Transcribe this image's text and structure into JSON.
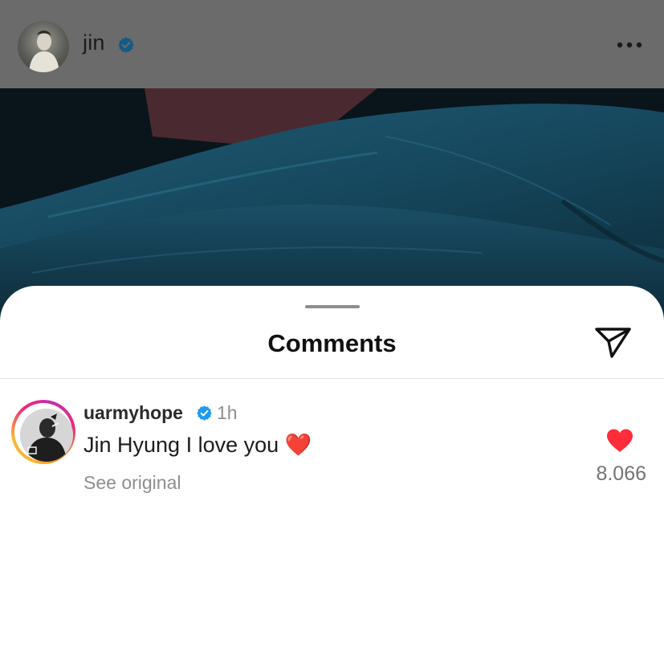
{
  "post": {
    "username": "jin",
    "verified": true,
    "more_icon": "more-horizontal-icon"
  },
  "comments_sheet": {
    "title": "Comments",
    "share_icon": "paper-plane-icon"
  },
  "comments": [
    {
      "username": "uarmyhope",
      "verified": true,
      "time": "1h",
      "text": "Jin Hyung I love you ❤️",
      "see_original_label": "See original",
      "like_count": "8.066",
      "liked": true
    }
  ],
  "colors": {
    "verified_blue": "#1d9bf0",
    "like_red": "#ff2d3a",
    "header_dim": "#6b6b6b"
  }
}
